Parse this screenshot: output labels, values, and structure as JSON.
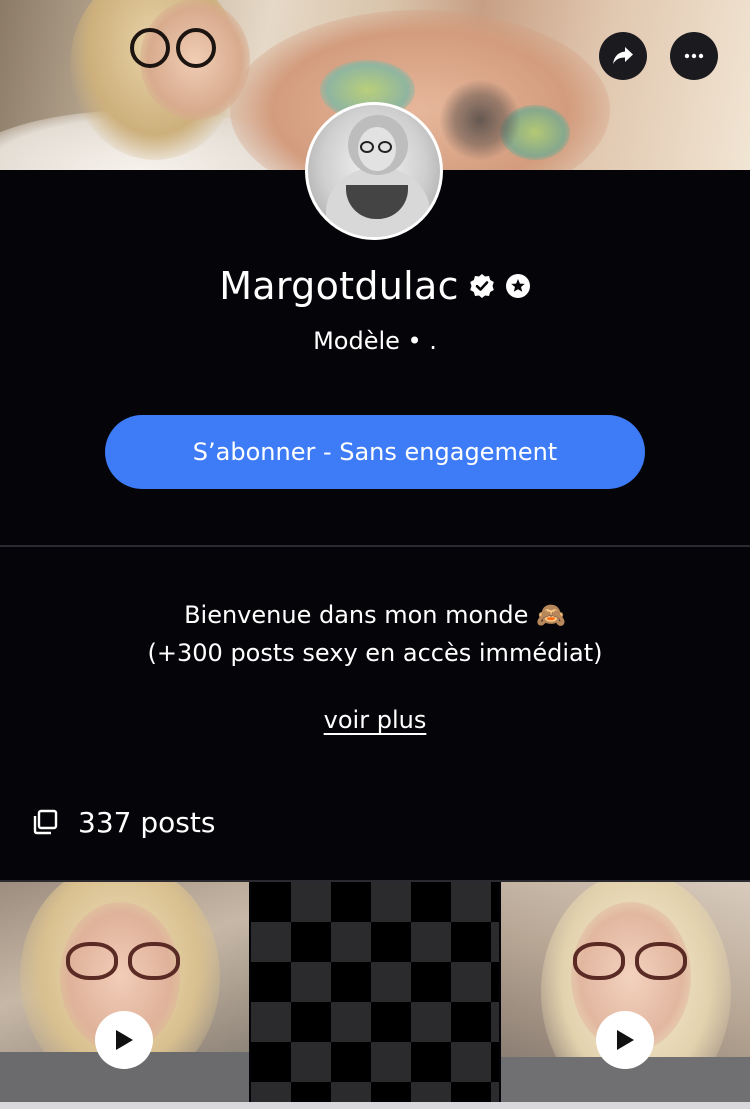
{
  "profile": {
    "name": "Margotdulac",
    "subtitle": "Modèle • .",
    "verified_icon": "verified-badge-icon",
    "star_icon": "star-badge-icon"
  },
  "actions": {
    "share_icon": "share-icon",
    "more_icon": "more-dots-icon",
    "subscribe_label": "S’abonner - Sans engagement"
  },
  "bio": {
    "line1": "Bienvenue dans mon monde 🙈",
    "line2": "(+300 posts sexy en accès immédiat)",
    "more_label": "voir plus"
  },
  "posts": {
    "count_label": "337 posts",
    "icon": "copy-icon"
  },
  "grid": {
    "tiles": [
      {
        "type": "video",
        "icon": "play-icon"
      },
      {
        "type": "locked-placeholder"
      },
      {
        "type": "video",
        "icon": "play-icon"
      }
    ]
  },
  "colors": {
    "background": "#050509",
    "accent": "#3d7bf7",
    "text": "#ffffff",
    "divider": "#2a2a30"
  }
}
